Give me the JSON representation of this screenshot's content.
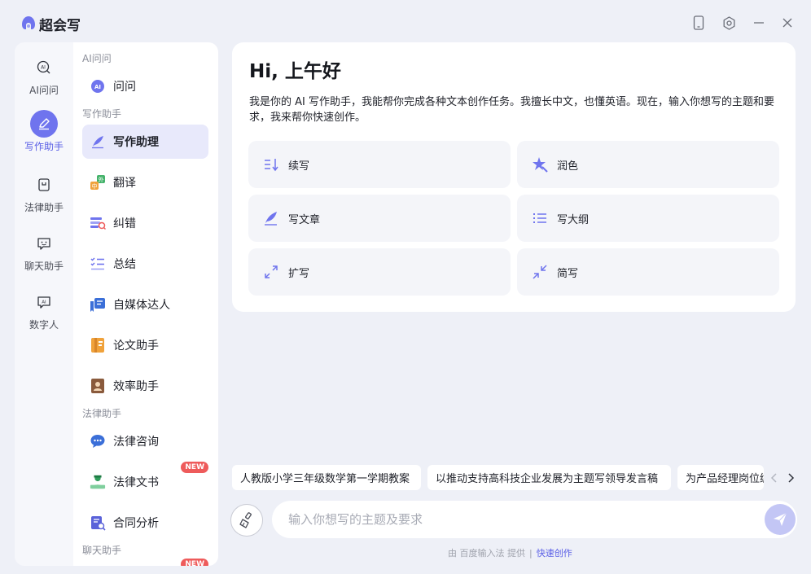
{
  "app": {
    "title": "超会写"
  },
  "rail": {
    "items": [
      {
        "label": "AI问问",
        "icon": "ai-chat-icon"
      },
      {
        "label": "写作助手",
        "icon": "pen-icon",
        "active": true
      },
      {
        "label": "法律助手",
        "icon": "law-icon"
      },
      {
        "label": "聊天助手",
        "icon": "chat-bubble-icon"
      },
      {
        "label": "数字人",
        "icon": "digital-human-icon"
      }
    ]
  },
  "sidebar": {
    "sections": {
      "ai": "AI问问",
      "writing": "写作助手",
      "law": "法律助手",
      "chat": "聊天助手"
    },
    "items": [
      {
        "label": "问问",
        "icon": "ai-badge-icon"
      },
      {
        "label": "写作助理",
        "icon": "quill-icon",
        "active": true
      },
      {
        "label": "翻译",
        "icon": "translate-icon"
      },
      {
        "label": "纠错",
        "icon": "proofread-icon"
      },
      {
        "label": "总结",
        "icon": "checklist-icon"
      },
      {
        "label": "自媒体达人",
        "icon": "media-icon"
      },
      {
        "label": "论文助手",
        "icon": "paper-icon"
      },
      {
        "label": "效率助手",
        "icon": "efficiency-icon"
      },
      {
        "label": "法律咨询",
        "icon": "consult-icon"
      },
      {
        "label": "法律文书",
        "icon": "legal-doc-icon",
        "badge": "NEW"
      },
      {
        "label": "合同分析",
        "icon": "contract-icon"
      }
    ],
    "extra_badge": "NEW"
  },
  "main": {
    "greeting": "Hi, 上午好",
    "intro": "我是你的 AI 写作助手，我能帮你完成各种文本创作任务。我擅长中文，也懂英语。现在，输入你想写的主题和要求，我来帮你快速创作。",
    "actions": [
      {
        "label": "续写",
        "icon": "continue-write-icon"
      },
      {
        "label": "润色",
        "icon": "polish-icon"
      },
      {
        "label": "写文章",
        "icon": "article-icon"
      },
      {
        "label": "写大纲",
        "icon": "outline-icon"
      },
      {
        "label": "扩写",
        "icon": "expand-icon"
      },
      {
        "label": "简写",
        "icon": "shorten-icon"
      }
    ]
  },
  "suggestions": [
    "人教版小学三年级数学第一学期教案",
    "以推动支持高科技企业发展为主题写领导发言稿",
    "为产品经理岗位编"
  ],
  "input": {
    "placeholder": "输入你想写的主题及要求"
  },
  "footer": {
    "provider": "由 百度输入法 提供",
    "sep": "|",
    "link": "快速创作"
  },
  "colors": {
    "accent": "#6f74ee",
    "badge": "#ee5b5b",
    "background": "#eef0f7"
  }
}
